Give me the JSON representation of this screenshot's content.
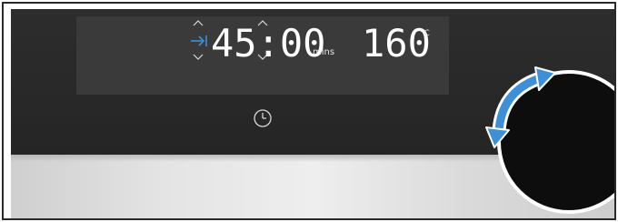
{
  "display": {
    "duration_value": "45:00",
    "duration_unit": "mins",
    "temperature_value": "160",
    "temperature_unit": "°C"
  },
  "icons": {
    "duration_icon": "arrow-to-bar-icon",
    "clock_icon": "clock-icon",
    "rotate_hint": "double-arrow-rotate-icon",
    "up_arrow": "chevron-up-icon",
    "down_arrow": "chevron-down-icon"
  },
  "colors": {
    "panel": "#2b2b2b",
    "display": "#3a3a3a",
    "digits": "#ffffff",
    "accent_blue": "#3f8fd6",
    "knob": "#0d0d0d"
  }
}
